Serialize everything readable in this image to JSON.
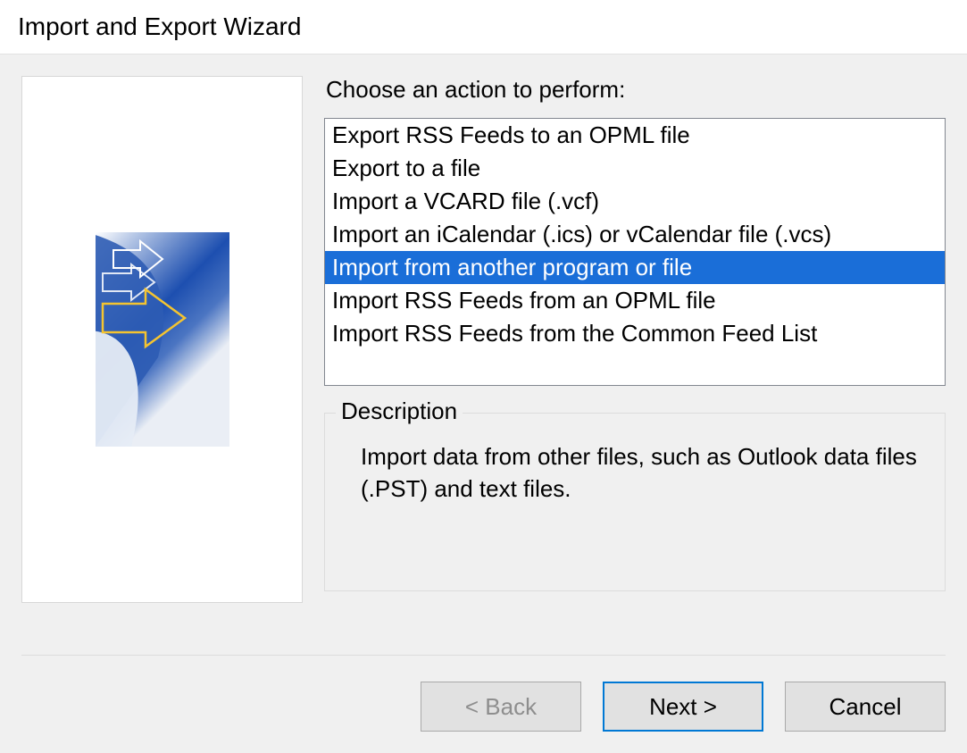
{
  "dialog": {
    "title": "Import and Export Wizard"
  },
  "main": {
    "prompt": "Choose an action to perform:",
    "actions": [
      {
        "label": "Export RSS Feeds to an OPML file",
        "selected": false
      },
      {
        "label": "Export to a file",
        "selected": false
      },
      {
        "label": "Import a VCARD file (.vcf)",
        "selected": false
      },
      {
        "label": "Import an iCalendar (.ics) or vCalendar file (.vcs)",
        "selected": false
      },
      {
        "label": "Import from another program or file",
        "selected": true
      },
      {
        "label": "Import RSS Feeds from an OPML file",
        "selected": false
      },
      {
        "label": "Import RSS Feeds from the Common Feed List",
        "selected": false
      }
    ],
    "description_group_label": "Description",
    "description_text": "Import data from other files, such as Outlook data files (.PST) and text files."
  },
  "buttons": {
    "back": "< Back",
    "next": "Next >",
    "cancel": "Cancel"
  }
}
